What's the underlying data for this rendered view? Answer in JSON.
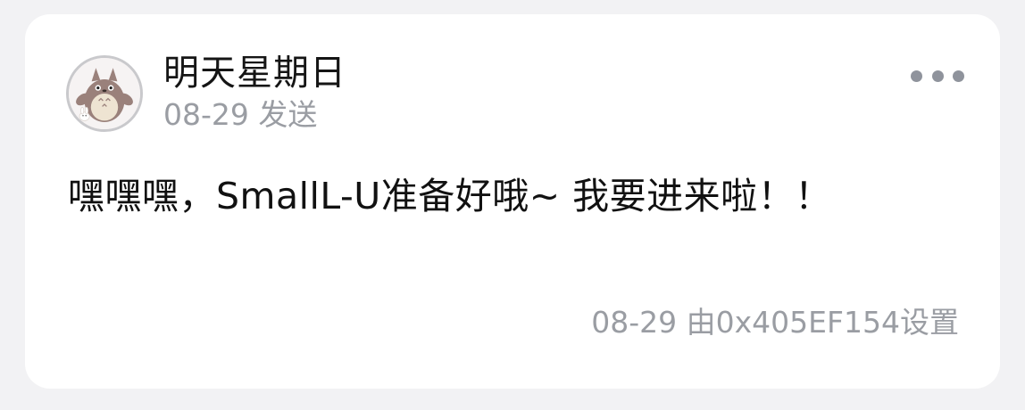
{
  "post": {
    "author": "明天星期日",
    "sent_time": "08-29 发送",
    "message": "嘿嘿嘿，SmallL-U准备好哦~ 我要进来啦！！",
    "footer": "08-29 由0x405EF154设置"
  },
  "icons": {
    "avatar": "totoro-avatar-icon",
    "more": "more-dots-icon"
  },
  "colors": {
    "background": "#f2f2f4",
    "card": "#ffffff",
    "primary_text": "#111111",
    "secondary_text": "#9a9da3",
    "dots": "#8f939c"
  }
}
